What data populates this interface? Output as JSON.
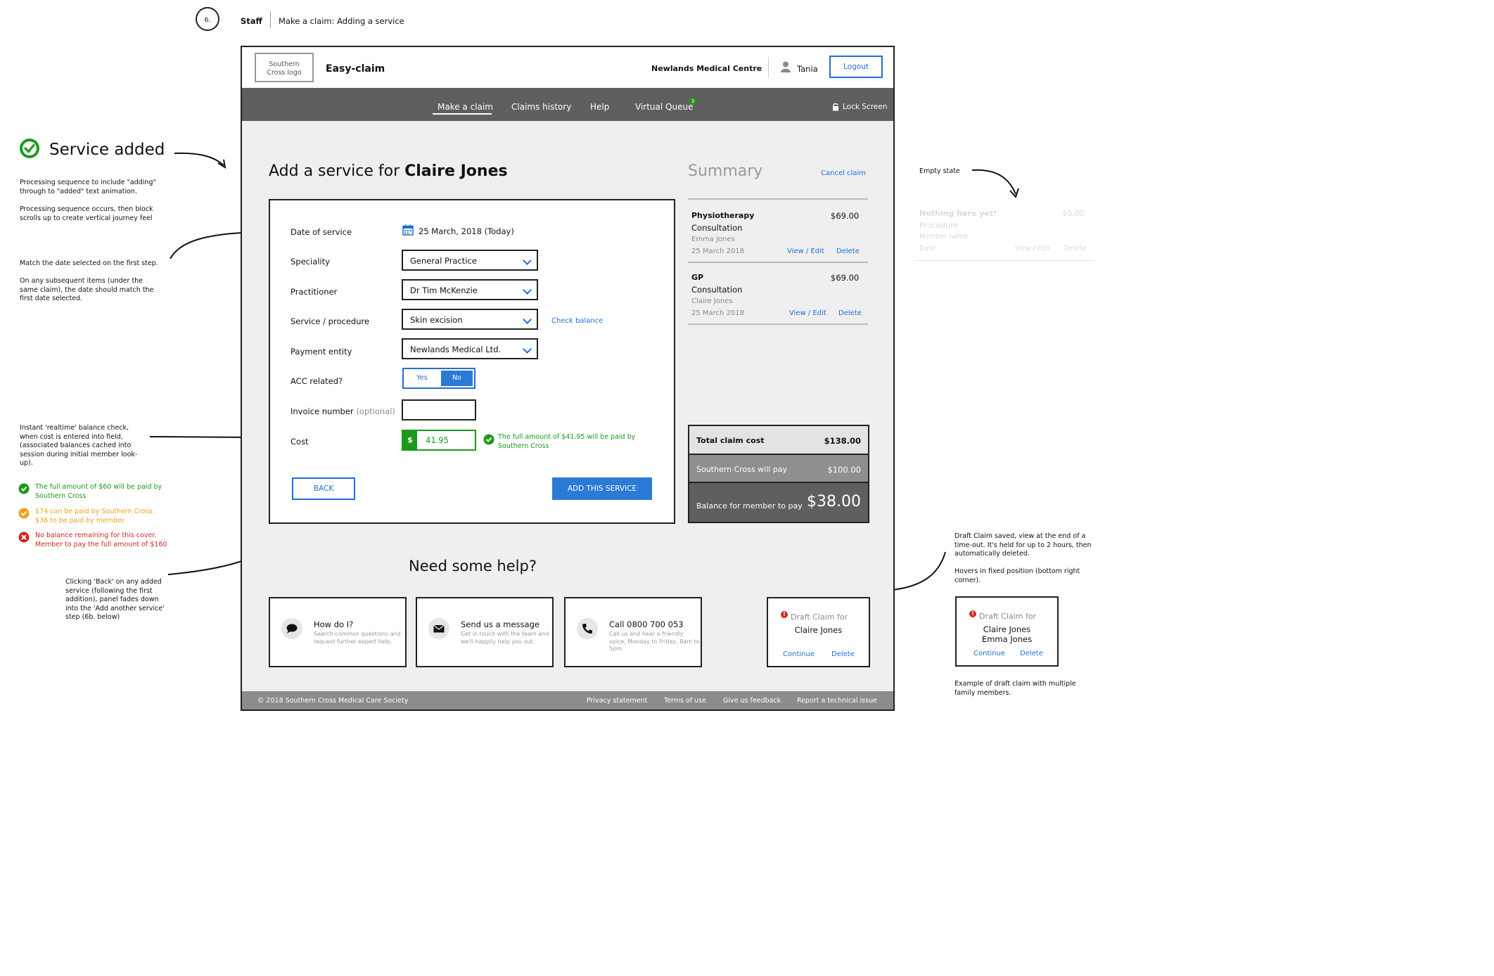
{
  "step": {
    "number": "6.",
    "section": "Staff",
    "title": "Make a claim: Adding a service"
  },
  "header": {
    "logo": "Southern Cross logo",
    "app_name": "Easy-claim",
    "practice": "Newlands Medical Centre",
    "user": "Tania",
    "logout": "Logout"
  },
  "nav": {
    "items": [
      "Make a claim",
      "Claims history",
      "Help",
      "Virtual Queue"
    ],
    "queue_badge": "3",
    "lock": "Lock Screen"
  },
  "form": {
    "title_prefix": "Add a service for ",
    "patient": "Claire Jones",
    "date_label": "Date of service",
    "date_value": "25 March, 2018 (Today)",
    "speciality_label": "Speciality",
    "speciality_value": "General Practice",
    "practitioner_label": "Practitioner",
    "practitioner_value": "Dr Tim McKenzie",
    "service_label": "Service / procedure",
    "service_value": "Skin excision",
    "check_balance": "Check balance",
    "payment_label": "Payment entity",
    "payment_value": "Newlands Medical Ltd.",
    "acc_label": "ACC related?",
    "acc_yes": "Yes",
    "acc_no": "No",
    "invoice_label": "Invoice number",
    "invoice_optional": "(optional)",
    "cost_label": "Cost",
    "cost_currency": "$",
    "cost_value": "41.95",
    "cost_msg": "The full amount of $41.95 will be paid by Southern Cross",
    "back": "BACK",
    "add": "ADD THIS SERVICE"
  },
  "summary": {
    "title": "Summary",
    "cancel": "Cancel claim",
    "items": [
      {
        "specialty": "Physiotherapy",
        "procedure": "Consultation",
        "member": "Emma Jones",
        "date": "25 March 2018",
        "amount": "$69.00",
        "view": "View / Edit",
        "delete": "Delete"
      },
      {
        "specialty": "GP",
        "procedure": "Consultation",
        "member": "Claire Jones",
        "date": "25 March 2018",
        "amount": "$69.00",
        "view": "View / Edit",
        "delete": "Delete"
      }
    ],
    "total_label": "Total claim cost",
    "total_value": "$138.00",
    "sc_label": "Southern Cross will pay",
    "sc_value": "$100.00",
    "balance_label": "Balance for member to pay",
    "balance_value": "$38.00"
  },
  "help": {
    "title": "Need some help?",
    "cards": [
      {
        "title": "How do I?",
        "text": "Search common questions and request further expert help."
      },
      {
        "title": "Send us a message",
        "text": "Get in touch with the team and we'll happily help you out."
      },
      {
        "title": "Call 0800 700 053",
        "text": "Call us and hear a friendly voice, Monday to Friday, 8am to 5pm."
      }
    ]
  },
  "draft": {
    "title": "Draft Claim for",
    "name": "Claire Jones",
    "continue": "Continue",
    "delete": "Delete"
  },
  "draft_example": {
    "title": "Draft Claim for",
    "name1": "Claire Jones",
    "name2": "Emma Jones",
    "continue": "Continue",
    "delete": "Delete"
  },
  "footer": {
    "copyright": "© 2018 Southern Cross Medical Care Society",
    "links": [
      "Privacy statement",
      "Terms of use",
      "Give us feedback",
      "Report a technical issue"
    ]
  },
  "annotations": {
    "service_added": "Service added",
    "processing1": "Processing sequence to include \"adding\" through to \"added\" text animation.",
    "processing2": "Processing sequence occurs, then block scrolls up to create vertical journey feel",
    "date1": "Match the date selected on the first step.",
    "date2": "On any subsequent items (under the same claim), the date should match the first date selected.",
    "balance_check": "Instant 'realtime' balance check, when cost is entered into field, (associated balances cached into session during initial member look-up).",
    "ex_green": "The full amount of $60 will be paid by Southern Cross",
    "ex_orange": "$74 can be paid by Southern Cross. $36 to be paid by member",
    "ex_red": "No balance remaining for this cover. Member to pay the full amount of $160",
    "back_note": "Clicking 'Back' on any added service (following the first addition), panel fades down into the 'Add another service' step (6b. below)",
    "empty_state": "Empty state",
    "empty_title": "Nothing here yet!",
    "empty_amount": "$0.00",
    "empty_procedure": "Procedure",
    "empty_member": "Member name",
    "empty_date": "Date",
    "empty_view": "View / Edit",
    "empty_delete": "Delete",
    "draft_note1": "Draft Claim saved, view at the end of a time-out. It's held for up to 2 hours, then automatically deleted.",
    "draft_note2": "Hovers in fixed position (bottom right corner).",
    "draft_example_note": "Example of draft claim with multiple family members."
  }
}
